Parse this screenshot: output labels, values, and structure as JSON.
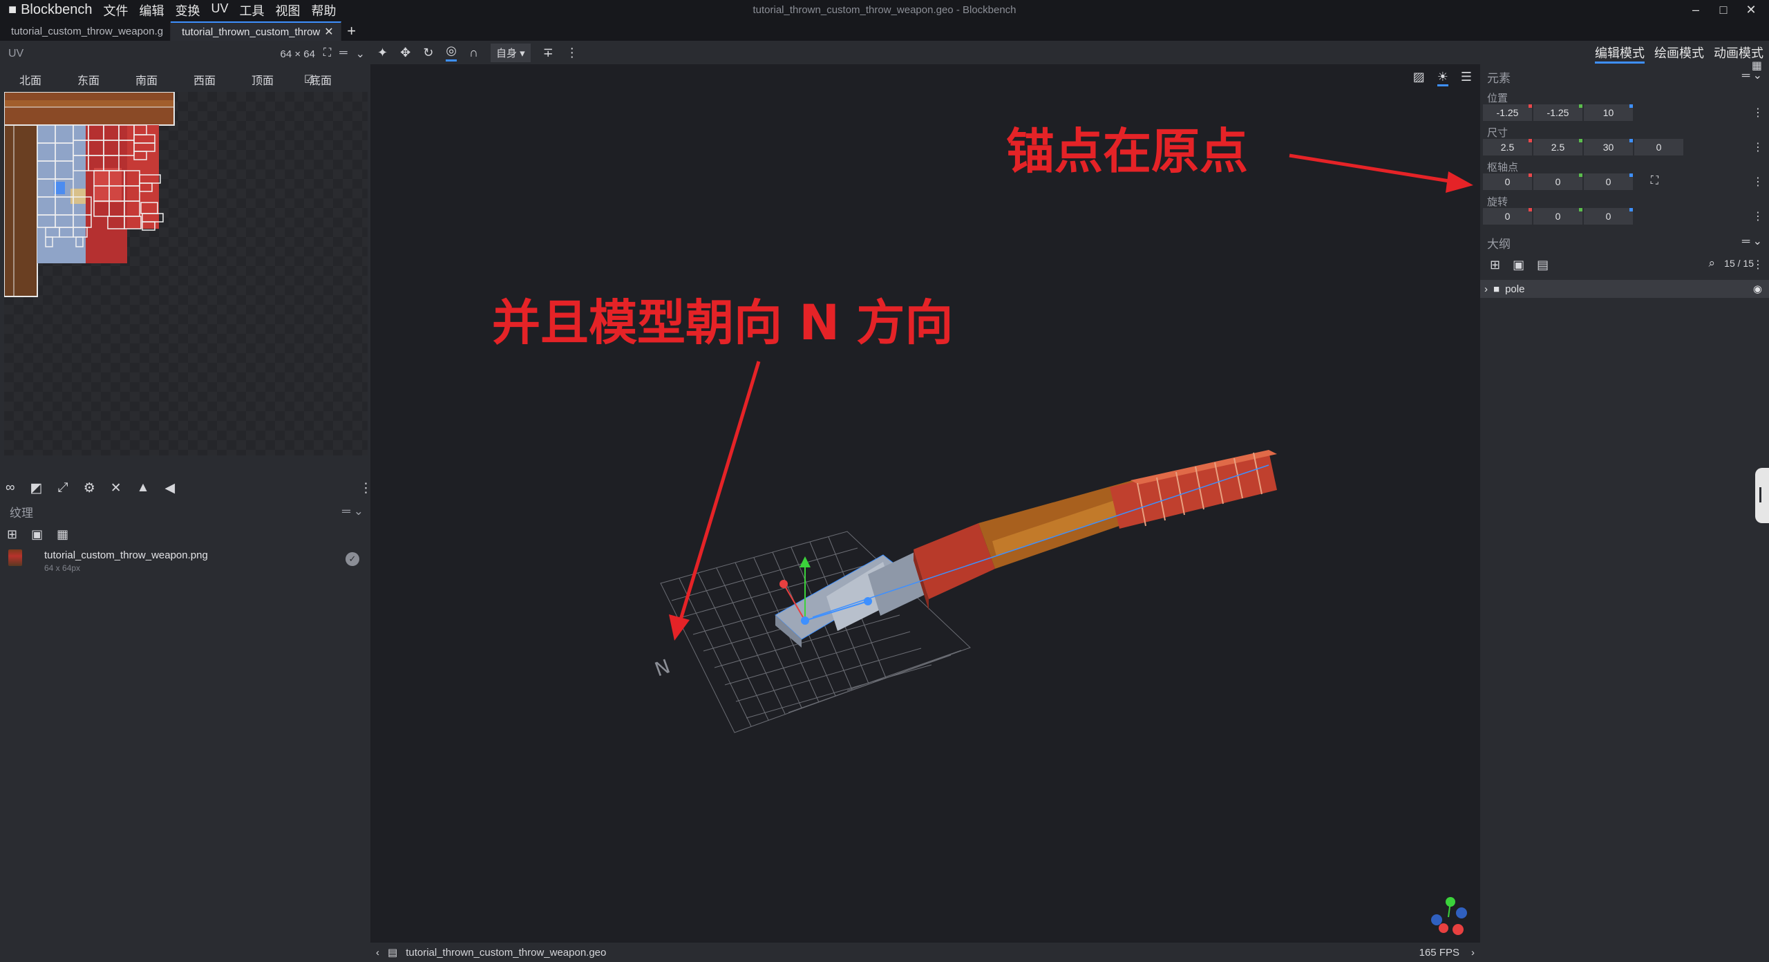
{
  "app": {
    "name": "Blockbench",
    "window_title": "tutorial_thrown_custom_throw_weapon.geo - Blockbench",
    "menus": [
      "文件",
      "编辑",
      "变换",
      "UV",
      "工具",
      "视图",
      "帮助"
    ]
  },
  "tabs": [
    {
      "label": "tutorial_custom_throw_weapon.g"
    },
    {
      "label": "tutorial_thrown_custom_throw"
    }
  ],
  "uv_panel": {
    "title": "UV",
    "size": "64 × 64",
    "faces": [
      "北面",
      "东面",
      "南面",
      "西面",
      "顶面",
      "底面"
    ]
  },
  "textures": {
    "title": "纹理",
    "items": [
      {
        "name": "tutorial_custom_throw_weapon.png",
        "dims": "64 x 64px"
      }
    ]
  },
  "toolbar": {
    "space_select": "自身"
  },
  "statusbar": {
    "file": "tutorial_thrown_custom_throw_weapon.geo",
    "fps": "165 FPS"
  },
  "modes": [
    "编辑模式",
    "绘画模式",
    "动画模式"
  ],
  "element": {
    "title": "元素",
    "position_label": "位置",
    "position": [
      "-1.25",
      "-1.25",
      "10"
    ],
    "size_label": "尺寸",
    "size": [
      "2.5",
      "2.5",
      "30",
      "0"
    ],
    "pivot_label": "枢轴点",
    "pivot": [
      "0",
      "0",
      "0"
    ],
    "rotation_label": "旋转",
    "rotation": [
      "0",
      "0",
      "0"
    ]
  },
  "outliner": {
    "title": "大纲",
    "count": "15 / 15",
    "items": [
      {
        "name": "pole"
      }
    ]
  },
  "annotations": {
    "pivot_note": "锚点在原点",
    "direction_note": "并且模型朝向 N 方向"
  },
  "colors": {
    "accent": "#3e90ff",
    "annotation": "#e52327"
  }
}
